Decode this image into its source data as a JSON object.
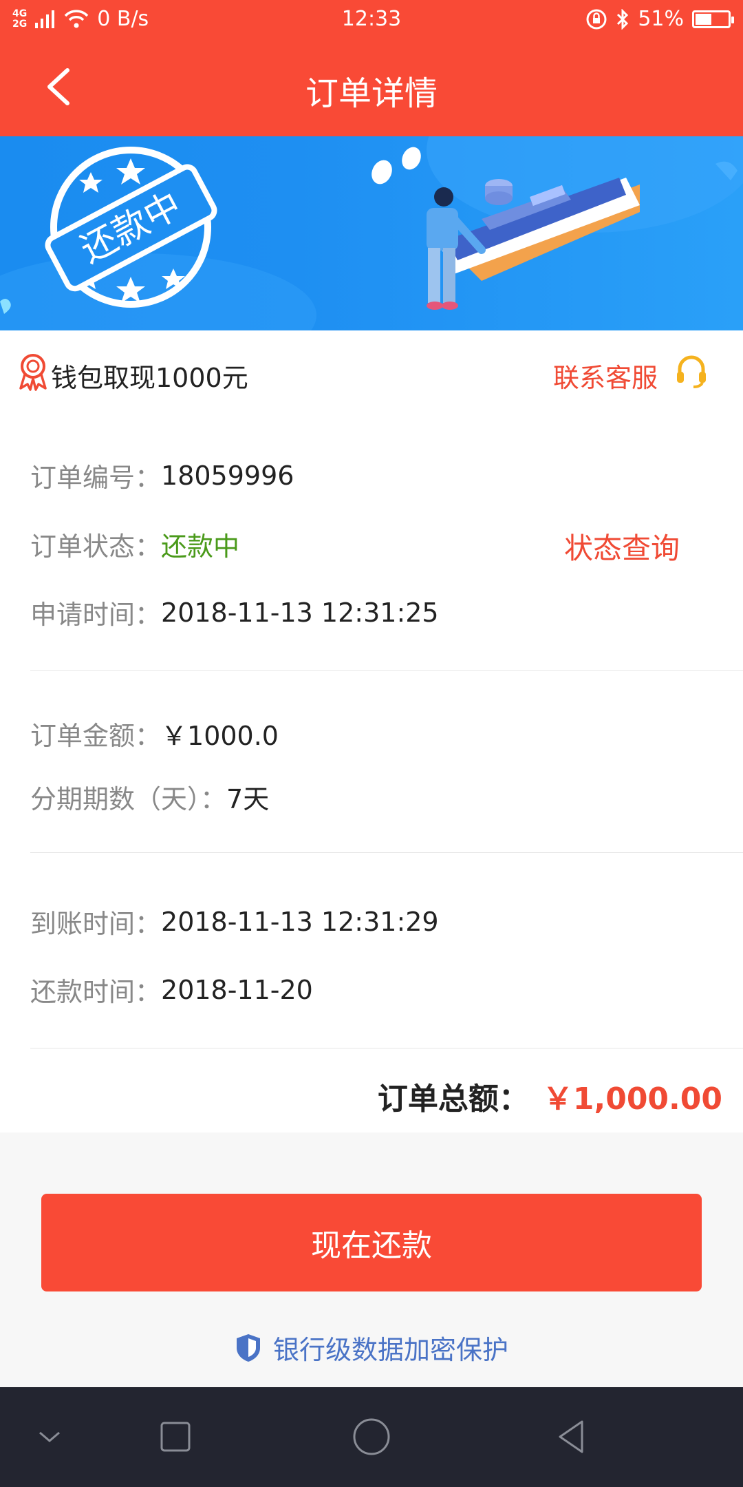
{
  "status_bar": {
    "network_top": "4G",
    "network_bottom": "2G",
    "speed": "0 B/s",
    "time": "12:33",
    "battery": "51%",
    "battery_level": 0.51
  },
  "nav": {
    "title": "订单详情"
  },
  "banner": {
    "stamp_text": "还款中"
  },
  "header": {
    "title": "钱包取现1000元",
    "service_label": "联系客服"
  },
  "order": {
    "number_label": "订单编号：",
    "number_value": "18059996",
    "status_label": "订单状态：",
    "status_value": "还款中",
    "status_query": "状态查询",
    "apply_time_label": "申请时间：",
    "apply_time_value": "2018-11-13 12:31:25",
    "amount_label": "订单金额：",
    "amount_value": "￥1000.0",
    "period_label": "分期期数（天）：",
    "period_value": "7天",
    "arrival_time_label": "到账时间：",
    "arrival_time_value": "2018-11-13 12:31:29",
    "repay_time_label": "还款时间：",
    "repay_time_value": "2018-11-20",
    "total_label": "订单总额：",
    "total_value": "￥1,000.00"
  },
  "actions": {
    "pay_label": "现在还款",
    "secure_label": "银行级数据加密保护"
  },
  "colors": {
    "brand_red": "#f94a36",
    "accent_red": "#f04a34",
    "status_green": "#4a9a1a",
    "link_blue": "#4a73c6",
    "banner_blue": "#1e8ff2"
  }
}
